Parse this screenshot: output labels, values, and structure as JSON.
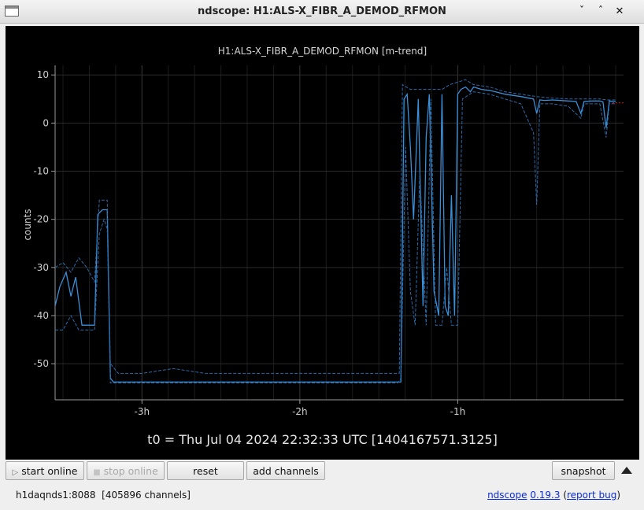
{
  "window": {
    "title": "ndscope: H1:ALS-X_FIBR_A_DEMOD_RFMON",
    "minimize_glyph": "ˇ",
    "restore_glyph": "ˆ",
    "close_glyph": "✕"
  },
  "chart_data": {
    "type": "line",
    "title": "H1:ALS-X_FIBR_A_DEMOD_RFMON [m-trend]",
    "xlabel": "",
    "ylabel": "counts",
    "x_unit": "hours relative to t0",
    "xlim": [
      -3.55,
      0.05
    ],
    "ylim": [
      -57.5,
      12
    ],
    "x_ticks": [
      -3,
      -2,
      -1
    ],
    "x_tick_labels": [
      "-3h",
      "-2h",
      "-1h"
    ],
    "y_ticks": [
      10,
      0,
      -10,
      -20,
      -30,
      -40,
      -50
    ],
    "y_tick_labels": [
      "10",
      "0",
      "-10",
      "-20",
      "-30",
      "-40",
      "-50"
    ],
    "grid": true,
    "colors": {
      "mean": "#3a8fd6",
      "minmax": "#2a6aa8",
      "reference": "#d02020"
    },
    "series": [
      {
        "role": "mean",
        "x": [
          -3.55,
          -3.52,
          -3.48,
          -3.45,
          -3.42,
          -3.38,
          -3.35,
          -3.3,
          -3.28,
          -3.25,
          -3.22,
          -3.2,
          -3.18,
          -3.15,
          -3.1,
          -3.0,
          -2.8,
          -2.6,
          -2.4,
          -2.2,
          -2.0,
          -1.8,
          -1.6,
          -1.4,
          -1.36,
          -1.34,
          -1.32,
          -1.3,
          -1.28,
          -1.25,
          -1.22,
          -1.2,
          -1.18,
          -1.15,
          -1.12,
          -1.1,
          -1.08,
          -1.06,
          -1.04,
          -1.02,
          -1.0,
          -0.98,
          -0.95,
          -0.92,
          -0.9,
          -0.85,
          -0.8,
          -0.7,
          -0.6,
          -0.52,
          -0.5,
          -0.48,
          -0.45,
          -0.4,
          -0.3,
          -0.25,
          -0.22,
          -0.2,
          -0.15,
          -0.1,
          -0.08,
          -0.06,
          -0.04,
          -0.02,
          0.0
        ],
        "y": [
          -38,
          -34,
          -31,
          -36,
          -32,
          -42,
          -42,
          -42,
          -19,
          -18,
          -18,
          -53,
          -53.8,
          -53.8,
          -53.8,
          -53.8,
          -53.8,
          -53.8,
          -53.8,
          -53.8,
          -53.8,
          -53.8,
          -53.8,
          -53.8,
          -53.8,
          5,
          6,
          -5,
          -20,
          5,
          -38,
          -3,
          6,
          -35,
          -40,
          6,
          -38,
          -40,
          -15,
          -40,
          6,
          7,
          7.5,
          6.5,
          7.5,
          7,
          6.8,
          6,
          5.5,
          5,
          2,
          4.8,
          4.7,
          4.8,
          4.6,
          4.5,
          2,
          4.5,
          4.6,
          4.6,
          4.4,
          -1,
          4.6,
          4.5,
          4.5
        ]
      },
      {
        "role": "max",
        "x": [
          -3.55,
          -3.5,
          -3.45,
          -3.4,
          -3.35,
          -3.3,
          -3.27,
          -3.24,
          -3.22,
          -3.2,
          -3.15,
          -3.0,
          -2.8,
          -2.6,
          -2.4,
          -2.2,
          -2.0,
          -1.8,
          -1.6,
          -1.4,
          -1.37,
          -1.35,
          -1.3,
          -1.25,
          -1.2,
          -1.15,
          -1.1,
          -1.05,
          -1.0,
          -0.95,
          -0.9,
          -0.8,
          -0.7,
          -0.6,
          -0.5,
          -0.4,
          -0.3,
          -0.2,
          -0.15,
          -0.1,
          -0.05,
          0.0
        ],
        "y": [
          -30,
          -29,
          -31,
          -28,
          -30,
          -33,
          -16,
          -16,
          -16,
          -50,
          -52,
          -52,
          -51,
          -52,
          -52,
          -52,
          -52,
          -52,
          -52,
          -52,
          -52,
          8,
          7,
          7,
          7,
          7,
          7,
          8,
          8.5,
          9,
          8,
          7.5,
          6.5,
          6,
          5.5,
          5.2,
          5,
          5,
          5,
          5,
          4.8,
          4.8
        ]
      },
      {
        "role": "min",
        "x": [
          -3.55,
          -3.5,
          -3.45,
          -3.4,
          -3.35,
          -3.3,
          -3.27,
          -3.24,
          -3.22,
          -3.2,
          -3.15,
          -3.0,
          -2.5,
          -2.0,
          -1.5,
          -1.38,
          -1.36,
          -1.33,
          -1.3,
          -1.27,
          -1.24,
          -1.2,
          -1.17,
          -1.14,
          -1.1,
          -1.07,
          -1.04,
          -1.0,
          -0.97,
          -0.9,
          -0.8,
          -0.6,
          -0.52,
          -0.5,
          -0.48,
          -0.4,
          -0.3,
          -0.22,
          -0.2,
          -0.1,
          -0.06,
          -0.04,
          0.0
        ],
        "y": [
          -43,
          -43,
          -40,
          -43,
          -43,
          -43,
          -23,
          -20,
          -22,
          -54,
          -54,
          -54,
          -54,
          -54,
          -54,
          -54,
          -53,
          -5,
          -35,
          -42,
          -10,
          -42,
          5,
          -42,
          -42,
          -30,
          -42,
          -42,
          5,
          6.5,
          6,
          4,
          -2,
          -17,
          4,
          4,
          3.5,
          1,
          4,
          4,
          -3,
          4,
          4
        ]
      }
    ],
    "reference_line": {
      "y": 4.2,
      "x_start": -0.02,
      "x_end": 0.05
    }
  },
  "plot": {
    "t0_text": "t0 = Thu Jul 04 2024 22:32:33 UTC [1404167571.3125]"
  },
  "toolbar": {
    "start_online_label": "start online",
    "stop_online_label": "stop online",
    "reset_label": "reset",
    "add_channels_label": "add channels",
    "snapshot_label": "snapshot",
    "start_online_icon": "▷",
    "stop_online_icon": "■"
  },
  "status": {
    "server": "h1daqnds1:8088",
    "channels": "[405896 channels]",
    "app_name": "ndscope",
    "version": "0.19.3",
    "open_paren": " (",
    "report_bug": "report bug",
    "close_paren": ")"
  }
}
